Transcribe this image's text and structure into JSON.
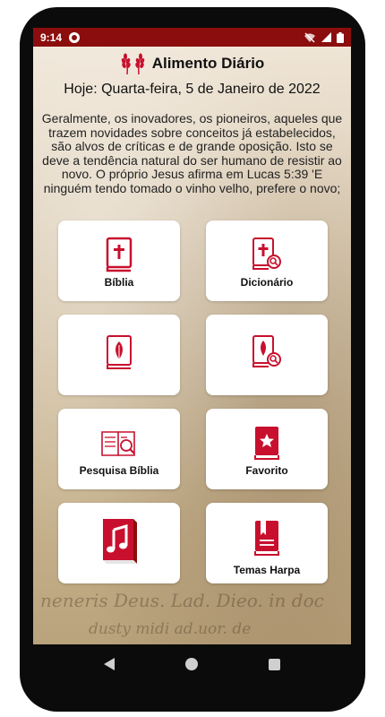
{
  "status_bar": {
    "time": "9:14",
    "icons": [
      "app-notification-icon",
      "wifi-off-icon",
      "signal-icon",
      "battery-icon"
    ]
  },
  "header": {
    "logo_icon": "wheat-icon",
    "title": "Alimento Diário"
  },
  "date_line": "Hoje: Quarta-feira, 5 de Janeiro de 2022",
  "devotional": {
    "text": "Geralmente, os inovadores, os pioneiros, aqueles que trazem novidades sobre conceitos já estabelecidos, são alvos de críticas e de grande oposição. Isto se deve a tendência natural do ser humano de resistir ao novo. O próprio Jesus afirma em Lucas 5:39 'E ninguém tendo tomado o vinho velho, prefere o novo;"
  },
  "background_script": [
    "neneris Deus. Lad. Dieo. in doc",
    "dusty midi ad.uor. de"
  ],
  "menu": [
    {
      "id": "biblia",
      "label": "Bíblia",
      "icon": "bible-cross-icon"
    },
    {
      "id": "dicionario",
      "label": "Dicionário",
      "icon": "bible-search-icon"
    },
    {
      "id": "harpa",
      "label": "",
      "icon": "hymnal-leaf-icon"
    },
    {
      "id": "harpa-busca",
      "label": "",
      "icon": "hymnal-search-icon"
    },
    {
      "id": "pesquisa",
      "label": "Pesquisa Bíblia",
      "icon": "book-magnifier-icon"
    },
    {
      "id": "favorito",
      "label": "Favorito",
      "icon": "star-book-icon"
    },
    {
      "id": "musica",
      "label": "",
      "icon": "music-book-icon"
    },
    {
      "id": "temas",
      "label": "Temas Harpa",
      "icon": "bookmark-book-icon"
    }
  ],
  "colors": {
    "accent": "#c8102e",
    "status_bar": "#8b0d0d",
    "tile_bg": "#ffffff"
  },
  "nav_bar": {
    "buttons": [
      "back-icon",
      "home-icon",
      "recents-icon"
    ]
  }
}
